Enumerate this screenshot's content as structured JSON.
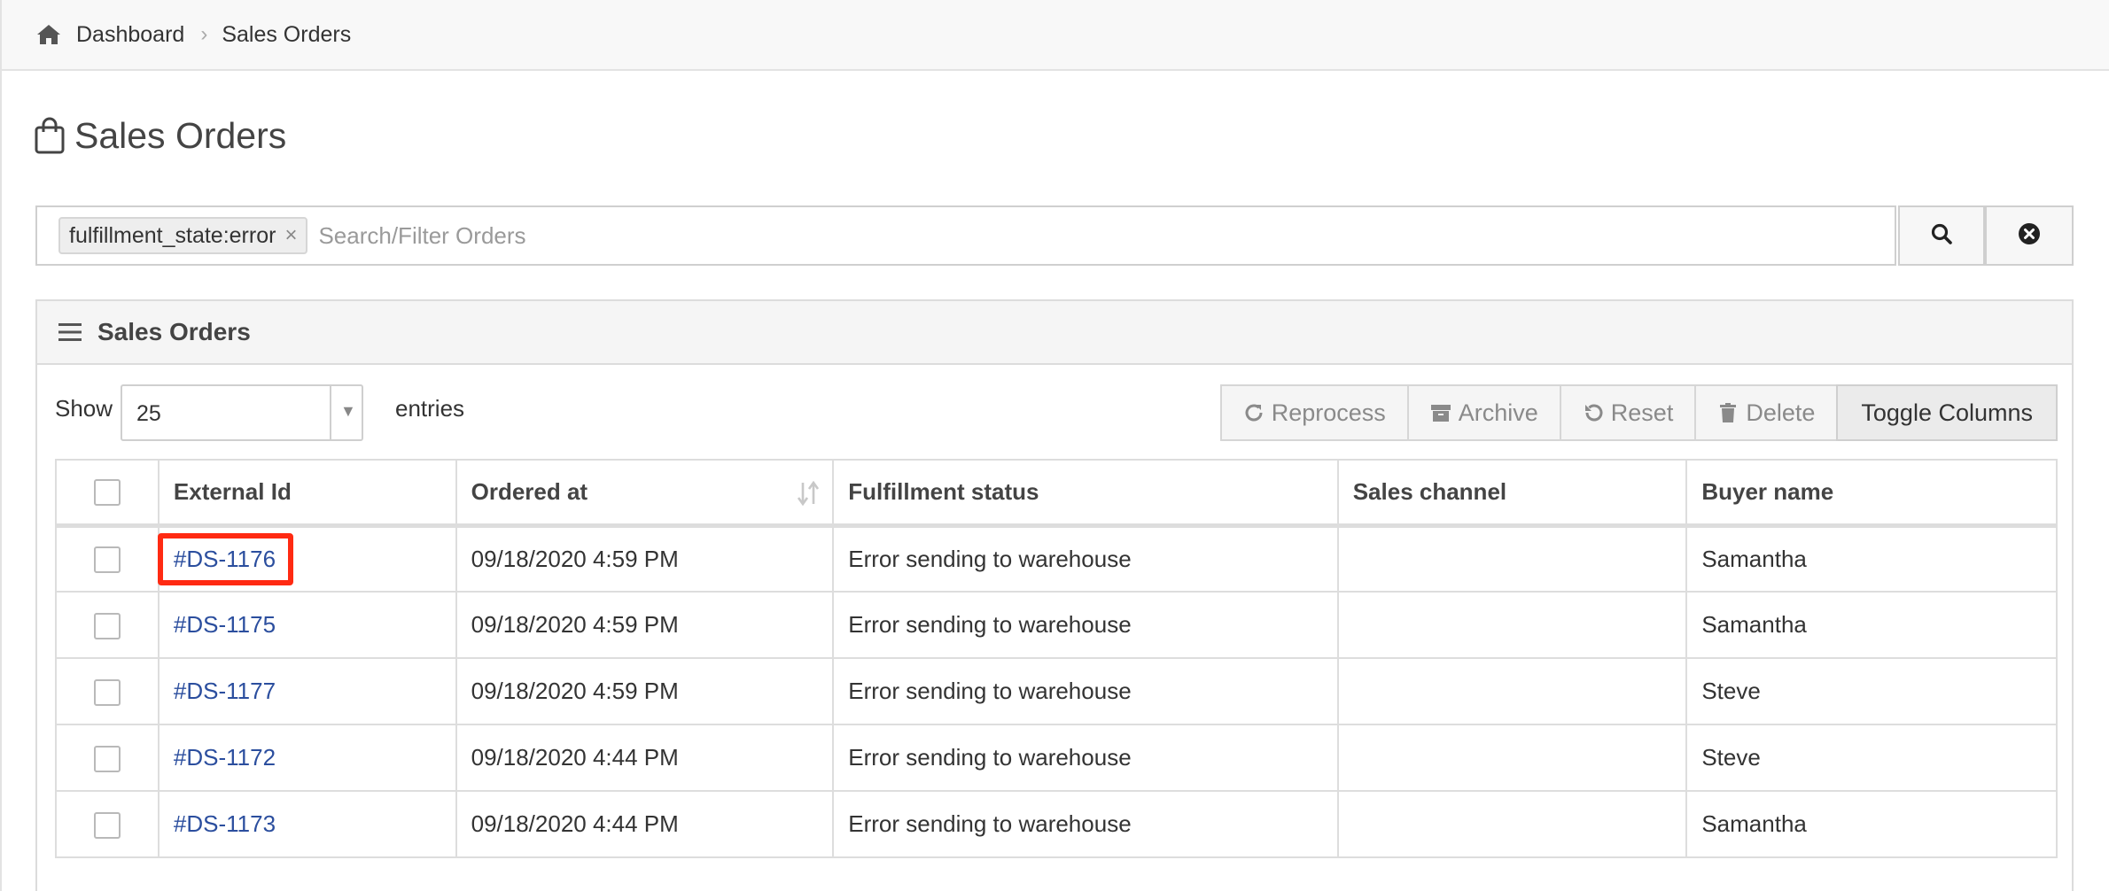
{
  "breadcrumb": {
    "home_icon": "home-icon",
    "items": [
      "Dashboard",
      "Sales Orders"
    ]
  },
  "page": {
    "title": "Sales Orders",
    "title_icon": "shopping-bag-icon"
  },
  "search": {
    "filter_tag": "fulfillment_state:error",
    "filter_tag_remove": "×",
    "placeholder": "Search/Filter Orders",
    "search_button_icon": "search-icon",
    "clear_button_icon": "close-circle-icon"
  },
  "panel": {
    "title": "Sales Orders",
    "title_icon": "menu-icon",
    "show_label": "Show",
    "entries_value": "25",
    "entries_label": "entries",
    "buttons": {
      "reprocess": "Reprocess",
      "archive": "Archive",
      "reset": "Reset",
      "delete": "Delete",
      "toggle_columns": "Toggle Columns"
    }
  },
  "table": {
    "columns": [
      "External Id",
      "Ordered at",
      "Fulfillment status",
      "Sales channel",
      "Buyer name"
    ],
    "rows": [
      {
        "external_id": "#DS-1176",
        "ordered_at": "09/18/2020 4:59 PM",
        "status": "Error sending to warehouse",
        "channel": "",
        "buyer": "Samantha"
      },
      {
        "external_id": "#DS-1175",
        "ordered_at": "09/18/2020 4:59 PM",
        "status": "Error sending to warehouse",
        "channel": "",
        "buyer": "Samantha"
      },
      {
        "external_id": "#DS-1177",
        "ordered_at": "09/18/2020 4:59 PM",
        "status": "Error sending to warehouse",
        "channel": "",
        "buyer": "Steve"
      },
      {
        "external_id": "#DS-1172",
        "ordered_at": "09/18/2020 4:44 PM",
        "status": "Error sending to warehouse",
        "channel": "",
        "buyer": "Steve"
      },
      {
        "external_id": "#DS-1173",
        "ordered_at": "09/18/2020 4:44 PM",
        "status": "Error sending to warehouse",
        "channel": "",
        "buyer": "Samantha"
      }
    ]
  },
  "colors": {
    "link": "#2b4e9e",
    "highlight": "#ff2a12"
  }
}
